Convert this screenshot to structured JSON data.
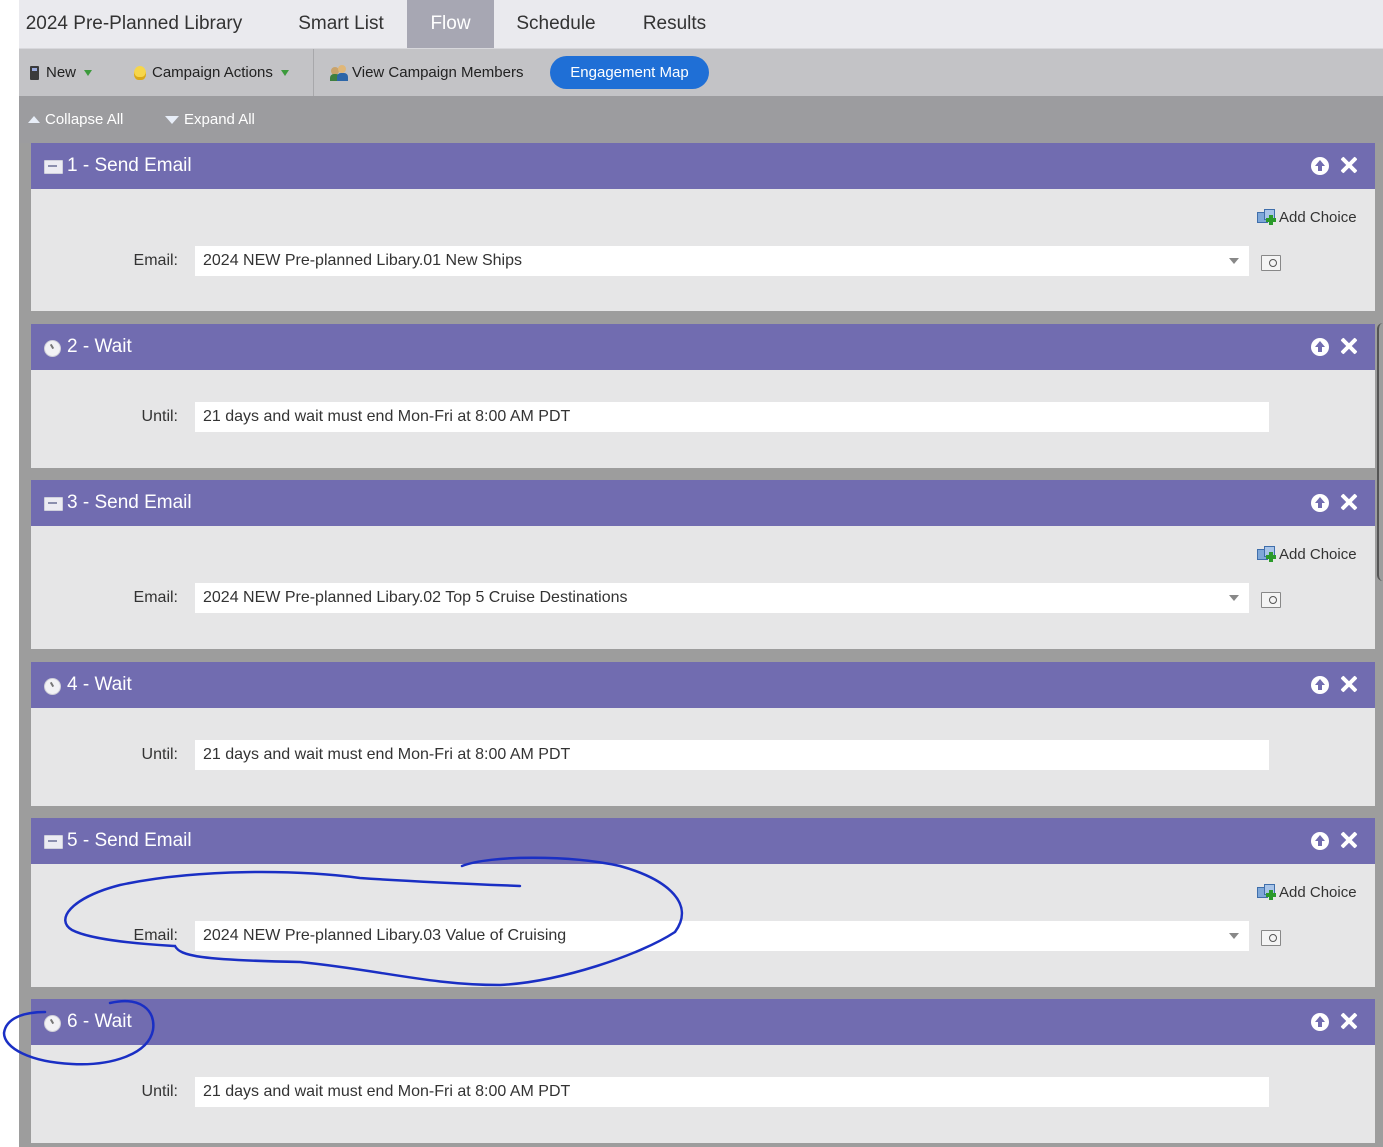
{
  "tabs": [
    {
      "label": "2024 Pre-Planned Library",
      "active": false
    },
    {
      "label": "Smart List",
      "active": false
    },
    {
      "label": "Flow",
      "active": true
    },
    {
      "label": "Schedule",
      "active": false
    },
    {
      "label": "Results",
      "active": false
    }
  ],
  "toolbar": {
    "new_label": "New",
    "campaign_actions_label": "Campaign Actions",
    "view_members_label": "View Campaign Members",
    "engagement_map_label": "Engagement Map"
  },
  "tree": {
    "collapse_label": "Collapse All",
    "expand_label": "Expand All"
  },
  "steps": [
    {
      "title": "1 - Send Email",
      "type": "email",
      "field_label": "Email:",
      "value": "2024 NEW Pre-planned Libary.01 New Ships",
      "add_choice": "Add Choice"
    },
    {
      "title": "2 - Wait",
      "type": "wait",
      "field_label": "Until:",
      "value": "21 days and wait must end Mon-Fri at 8:00 AM PDT"
    },
    {
      "title": "3 - Send Email",
      "type": "email",
      "field_label": "Email:",
      "value": "2024 NEW Pre-planned Libary.02 Top 5 Cruise Destinations",
      "add_choice": "Add Choice"
    },
    {
      "title": "4 - Wait",
      "type": "wait",
      "field_label": "Until:",
      "value": "21 days and wait must end Mon-Fri at 8:00 AM PDT"
    },
    {
      "title": "5 - Send Email",
      "type": "email",
      "field_label": "Email:",
      "value": "2024 NEW Pre-planned Libary.03 Value of Cruising",
      "add_choice": "Add Choice"
    },
    {
      "title": "6 - Wait",
      "type": "wait",
      "field_label": "Until:",
      "value": "21 days and wait must end Mon-Fri at 8:00 AM PDT"
    }
  ],
  "colors": {
    "step_header": "#716cb0",
    "active_tab": "#a7a7b3",
    "engagement_button": "#1f6fd6",
    "annotation_ink": "#1a2fc4"
  },
  "icons": {
    "new": "document-icon",
    "campaign_actions": "lightbulb-icon",
    "view_members": "people-icon",
    "email_step": "envelope-icon",
    "wait_step": "clock-icon",
    "move_up": "arrow-up-circle-icon",
    "delete": "close-icon",
    "add_choice": "add-choice-icon",
    "preview": "preview-icon"
  }
}
